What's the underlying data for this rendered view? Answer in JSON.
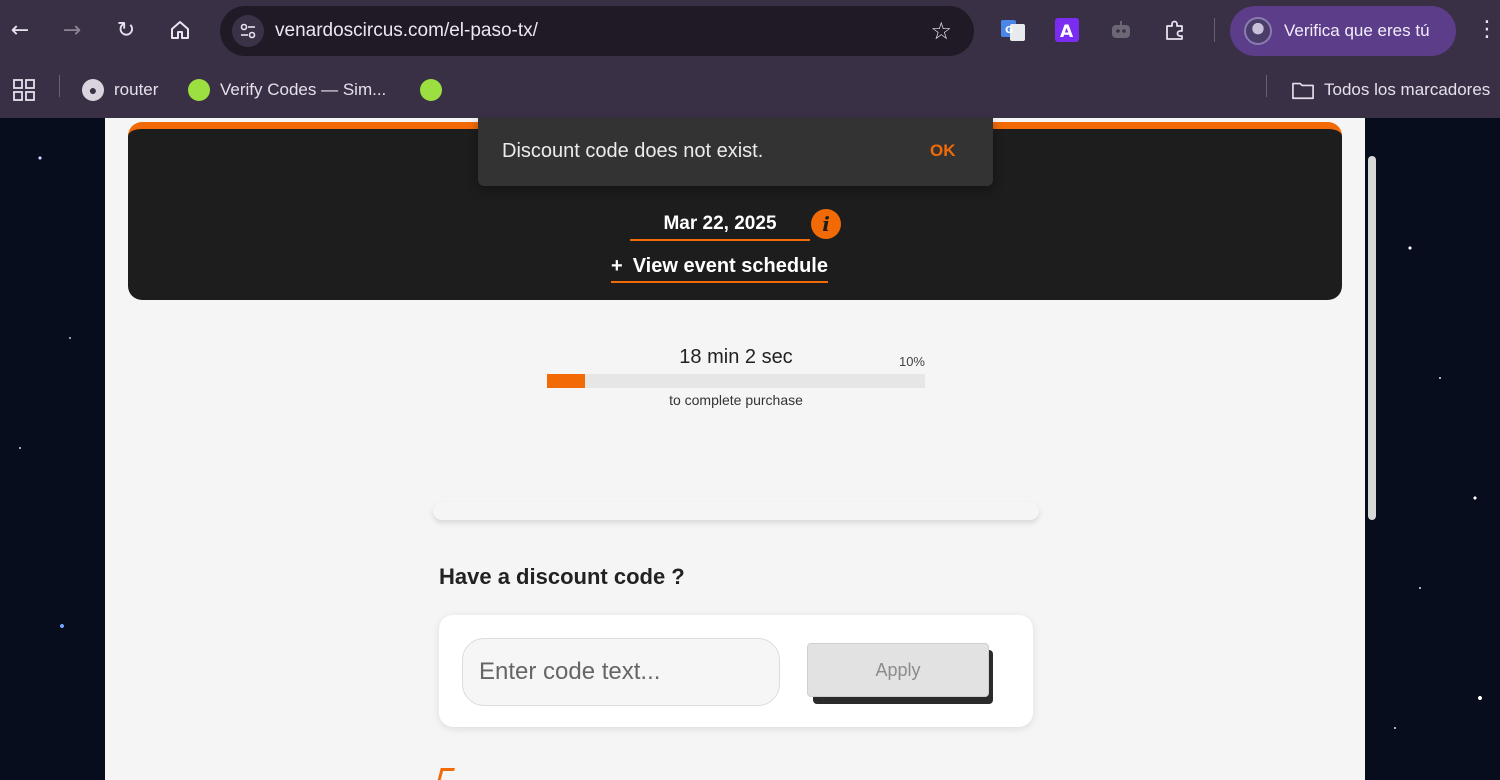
{
  "browser": {
    "url": "venardoscircus.com/el-paso-tx/",
    "profile_label": "Verifica que eres tú",
    "bookmarks": [
      {
        "label": "router",
        "icon": "globe-icon"
      },
      {
        "label": "Verify Codes — Sim...",
        "icon": "leaf-icon"
      },
      {
        "label": "",
        "icon": "leaf-icon"
      }
    ],
    "all_bookmarks_label": "Todos los marcadores"
  },
  "event": {
    "date": "Mar 22, 2025",
    "schedule_plus": "+",
    "schedule_label": "View event schedule"
  },
  "timer": {
    "time_left": "18 min 2 sec",
    "percent_label": "10%",
    "progress": 0.1,
    "caption": "to complete purchase"
  },
  "discount": {
    "title": "Have a discount code ?",
    "placeholder": "Enter code text...",
    "apply_label": "Apply"
  },
  "snackbar": {
    "message": "Discount code does not exist.",
    "action": "OK"
  },
  "colors": {
    "accent": "#f26a06",
    "event_card_bg": "#1d1d1d",
    "page_bg": "#f5f5f5",
    "browser_bg": "#3a3045"
  }
}
